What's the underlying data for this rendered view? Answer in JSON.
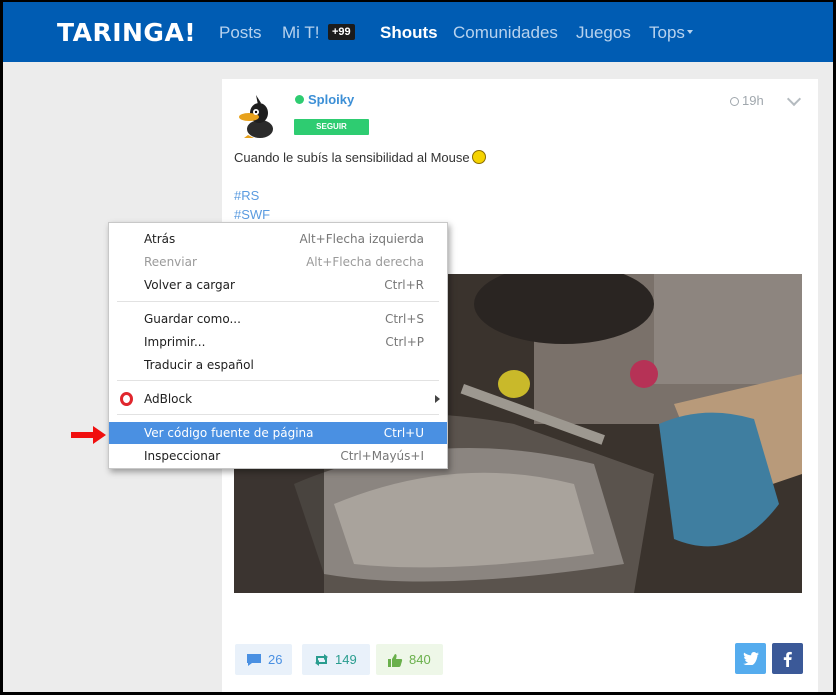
{
  "header": {
    "logo": "TARINGA!",
    "nav": [
      "Posts",
      "Mi T!",
      "Shouts",
      "Comunidades",
      "Juegos",
      "Tops"
    ],
    "badge": "+99",
    "active": "Shouts"
  },
  "post": {
    "author": "Sploiky",
    "follow_label": "SEGUIR",
    "time": "19h",
    "text": "Cuando le subís la sensibilidad al Mouse",
    "tags": [
      "#RS",
      "#SWF"
    ],
    "comments": "26",
    "reshares": "149",
    "likes": "840"
  },
  "context_menu": {
    "items": [
      {
        "label": "Atrás",
        "shortcut": "Alt+Flecha izquierda"
      },
      {
        "label": "Reenviar",
        "shortcut": "Alt+Flecha derecha"
      },
      {
        "label": "Volver a cargar",
        "shortcut": "Ctrl+R"
      },
      {
        "label": "Guardar como...",
        "shortcut": "Ctrl+S"
      },
      {
        "label": "Imprimir...",
        "shortcut": "Ctrl+P"
      },
      {
        "label": "Traducir a español",
        "shortcut": ""
      },
      {
        "label": "AdBlock",
        "shortcut": ""
      },
      {
        "label": "Ver código fuente de página",
        "shortcut": "Ctrl+U"
      },
      {
        "label": "Inspeccionar",
        "shortcut": "Ctrl+Mayús+I"
      }
    ]
  },
  "colors": {
    "brand": "#005cb3",
    "follow": "#2ecc71",
    "highlight": "#4a90e2",
    "twitter": "#55acee",
    "facebook": "#3b5998"
  },
  "icons": [
    "clock-icon",
    "chevron-down-icon",
    "comment-icon",
    "reshare-icon",
    "like-icon",
    "twitter-icon",
    "facebook-icon",
    "opera-adblock-icon",
    "red-arrow-icon"
  ]
}
